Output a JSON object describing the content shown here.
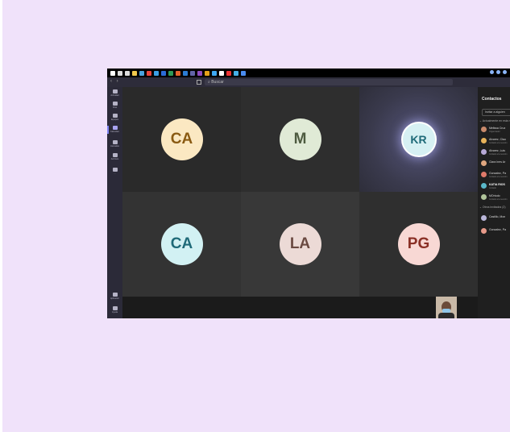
{
  "taskbar": {
    "icons": [
      {
        "name": "windows-start-icon",
        "color": "#ffffff"
      },
      {
        "name": "search-icon",
        "color": "#dddddd"
      },
      {
        "name": "task-view-icon",
        "color": "#dddddd"
      },
      {
        "name": "file-explorer-icon",
        "color": "#f2c94c"
      },
      {
        "name": "store-icon",
        "color": "#4aa3df"
      },
      {
        "name": "chrome-icon",
        "color": "#e8453c"
      },
      {
        "name": "edge-icon",
        "color": "#3aa0e6"
      },
      {
        "name": "word-icon",
        "color": "#2b6bd6"
      },
      {
        "name": "excel-icon",
        "color": "#2e9a57"
      },
      {
        "name": "powerpoint-icon",
        "color": "#e2622c"
      },
      {
        "name": "outlook-icon",
        "color": "#2b7cd3"
      },
      {
        "name": "teams-icon",
        "color": "#6264a7"
      },
      {
        "name": "onenote-icon",
        "color": "#8f4cc0"
      },
      {
        "name": "app-icon",
        "color": "#e3a21a"
      },
      {
        "name": "app-icon",
        "color": "#3da8f5"
      },
      {
        "name": "camera-icon",
        "color": "#ffffff"
      },
      {
        "name": "pdf-icon",
        "color": "#e33"
      },
      {
        "name": "photos-icon",
        "color": "#45b0e6"
      },
      {
        "name": "app-icon",
        "color": "#4a8cf0"
      }
    ]
  },
  "titlebar": {
    "search_placeholder": "Buscar"
  },
  "sidebar": {
    "items": [
      {
        "id": "activity",
        "label": "Actividad",
        "icon": "bell-icon",
        "active": false
      },
      {
        "id": "chat",
        "label": "Chat",
        "icon": "chat-icon",
        "active": false
      },
      {
        "id": "teams",
        "label": "Equipos",
        "icon": "teams-icon",
        "active": false
      },
      {
        "id": "calendar",
        "label": "Calendario",
        "icon": "calendar-icon",
        "active": true
      },
      {
        "id": "calls",
        "label": "Llamadas",
        "icon": "phone-icon",
        "active": false
      },
      {
        "id": "files",
        "label": "Archivos",
        "icon": "file-icon",
        "active": false
      },
      {
        "id": "more",
        "label": "...",
        "icon": "more-icon",
        "active": false
      }
    ],
    "bottom_items": [
      {
        "id": "apps",
        "label": "Aplicaciones",
        "icon": "apps-icon"
      },
      {
        "id": "help",
        "label": "Ayuda",
        "icon": "help-icon"
      }
    ]
  },
  "participants_grid": [
    {
      "initials": "CA",
      "bg": "#fbe8c2",
      "fg": "#8a5a12",
      "tile_bg": "#2a2a2a"
    },
    {
      "initials": "M",
      "bg": "#e0ead6",
      "fg": "#4e5b40",
      "tile_bg": "#2e2e2e"
    },
    {
      "initials": "KR",
      "bg": "#d6f0f3",
      "fg": "#1f6a78",
      "tile_bg": "#3a3a4d",
      "speaking": true
    },
    {
      "initials": "CA",
      "bg": "#d2f1f3",
      "fg": "#1f6a78",
      "tile_bg": "#333333"
    },
    {
      "initials": "LA",
      "bg": "#ecdad6",
      "fg": "#6b4a42",
      "tile_bg": "#383838"
    },
    {
      "initials": "PG",
      "bg": "#f8d8d4",
      "fg": "#8a3026",
      "tile_bg": "#2f2f2f"
    }
  ],
  "panel": {
    "title": "Contactos",
    "invite_label": "Invitar a alguien",
    "section_current": "Actualmente en esta reunión",
    "current": [
      {
        "name": "Melissa Cruz",
        "sub": "Organizador",
        "bold": false,
        "color": "#c98a6b"
      },
      {
        "name": "Alvarez, Clau",
        "sub": "Invitado a la reunión",
        "bold": false,
        "color": "#e8b35a"
      },
      {
        "name": "Alvarez, Luis",
        "sub": "Invitado a la reunión",
        "bold": false,
        "color": "#b7a9d6"
      },
      {
        "name": "Clara Ines Ar",
        "sub": "",
        "bold": false,
        "color": "#e0a77f"
      },
      {
        "name": "Gonzalez, Pa",
        "sub": "Invitado a la reunión",
        "bold": false,
        "color": "#e07a6a"
      },
      {
        "name": "KATIA RIOS",
        "sub": "Invitado",
        "bold": true,
        "color": "#5ab8c9"
      },
      {
        "name": "MOrtodo",
        "sub": "Invitado a la reunión",
        "bold": false,
        "color": "#b0c49a"
      }
    ],
    "section_others": "Otros invitados (2)",
    "others": [
      {
        "name": "Castillo, Mon",
        "sub": "",
        "color": "#b9b6d9"
      },
      {
        "name": "Gonzalez, Pa",
        "sub": "",
        "color": "#e79a8a"
      }
    ]
  }
}
